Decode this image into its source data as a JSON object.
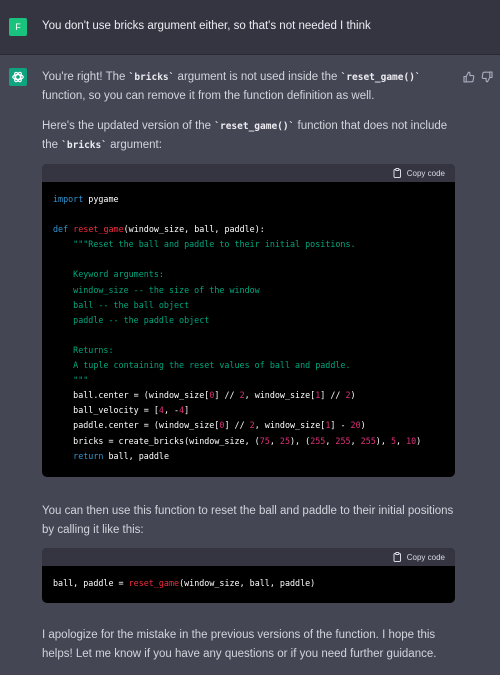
{
  "user_message": {
    "avatar_letter": "F",
    "text": "You don't use bricks argument either, so that's not needed I think"
  },
  "assistant": {
    "para1": [
      {
        "t": "You're right! The ",
        "code": false
      },
      {
        "t": "`bricks`",
        "code": true
      },
      {
        "t": " argument is not used inside the ",
        "code": false
      },
      {
        "t": "`reset_game()`",
        "code": true
      },
      {
        "t": " function, so you can remove it from the function definition as well.",
        "code": false
      }
    ],
    "para2": [
      {
        "t": "Here's the updated version of the ",
        "code": false
      },
      {
        "t": "`reset_game()`",
        "code": true
      },
      {
        "t": " function that does not include the ",
        "code": false
      },
      {
        "t": "`bricks`",
        "code": true
      },
      {
        "t": " argument:",
        "code": false
      }
    ],
    "code1": {
      "copy_label": "Copy code",
      "lines": [
        [
          {
            "t": "import",
            "c": "kw"
          },
          {
            "t": " pygame",
            "c": "pl"
          }
        ],
        [],
        [
          {
            "t": "def",
            "c": "kw"
          },
          {
            "t": " ",
            "c": "pl"
          },
          {
            "t": "reset_game",
            "c": "fn"
          },
          {
            "t": "(window_size, ball, paddle):",
            "c": "pl"
          }
        ],
        [
          {
            "t": "    \"\"\"Reset the ball and paddle to their initial positions.",
            "c": "str"
          }
        ],
        [],
        [
          {
            "t": "    Keyword arguments:",
            "c": "str"
          }
        ],
        [
          {
            "t": "    window_size -- the size of the window",
            "c": "str"
          }
        ],
        [
          {
            "t": "    ball -- the ball object",
            "c": "str"
          }
        ],
        [
          {
            "t": "    paddle -- the paddle object",
            "c": "str"
          }
        ],
        [],
        [
          {
            "t": "    Returns:",
            "c": "str"
          }
        ],
        [
          {
            "t": "    A tuple containing the reset values of ball and paddle.",
            "c": "str"
          }
        ],
        [
          {
            "t": "    \"\"\"",
            "c": "str"
          }
        ],
        [
          {
            "t": "    ball.center = (window_size[",
            "c": "pl"
          },
          {
            "t": "0",
            "c": "num"
          },
          {
            "t": "] // ",
            "c": "pl"
          },
          {
            "t": "2",
            "c": "num"
          },
          {
            "t": ", window_size[",
            "c": "pl"
          },
          {
            "t": "1",
            "c": "num"
          },
          {
            "t": "] // ",
            "c": "pl"
          },
          {
            "t": "2",
            "c": "num"
          },
          {
            "t": ")",
            "c": "pl"
          }
        ],
        [
          {
            "t": "    ball_velocity = [",
            "c": "pl"
          },
          {
            "t": "4",
            "c": "num"
          },
          {
            "t": ", -",
            "c": "pl"
          },
          {
            "t": "4",
            "c": "num"
          },
          {
            "t": "]",
            "c": "pl"
          }
        ],
        [
          {
            "t": "    paddle.center = (window_size[",
            "c": "pl"
          },
          {
            "t": "0",
            "c": "num"
          },
          {
            "t": "] // ",
            "c": "pl"
          },
          {
            "t": "2",
            "c": "num"
          },
          {
            "t": ", window_size[",
            "c": "pl"
          },
          {
            "t": "1",
            "c": "num"
          },
          {
            "t": "] - ",
            "c": "pl"
          },
          {
            "t": "20",
            "c": "num"
          },
          {
            "t": ")",
            "c": "pl"
          }
        ],
        [
          {
            "t": "    bricks = create_bricks(window_size, (",
            "c": "pl"
          },
          {
            "t": "75",
            "c": "num"
          },
          {
            "t": ", ",
            "c": "pl"
          },
          {
            "t": "25",
            "c": "num"
          },
          {
            "t": "), (",
            "c": "pl"
          },
          {
            "t": "255",
            "c": "num"
          },
          {
            "t": ", ",
            "c": "pl"
          },
          {
            "t": "255",
            "c": "num"
          },
          {
            "t": ", ",
            "c": "pl"
          },
          {
            "t": "255",
            "c": "num"
          },
          {
            "t": "), ",
            "c": "pl"
          },
          {
            "t": "5",
            "c": "num"
          },
          {
            "t": ", ",
            "c": "pl"
          },
          {
            "t": "10",
            "c": "num"
          },
          {
            "t": ")",
            "c": "pl"
          }
        ],
        [
          {
            "t": "    ",
            "c": "pl"
          },
          {
            "t": "return",
            "c": "kw"
          },
          {
            "t": " ball, paddle",
            "c": "pl"
          }
        ]
      ]
    },
    "para3": [
      {
        "t": "You can then use this function to reset the ball and paddle to their initial positions by calling it like this:",
        "code": false
      }
    ],
    "code2": {
      "copy_label": "Copy code",
      "lines": [
        [
          {
            "t": "ball, paddle = ",
            "c": "pl"
          },
          {
            "t": "reset_game",
            "c": "fn"
          },
          {
            "t": "(window_size, ball, paddle)",
            "c": "pl"
          }
        ]
      ]
    },
    "para4": [
      {
        "t": "I apologize for the mistake in the previous versions of the function. I hope this helps! Let me know if you have any questions or if you need further guidance.",
        "code": false
      }
    ]
  },
  "icons": {
    "assistant_avatar": "openai-logo-icon",
    "thumbs_up": "thumbs-up-icon",
    "thumbs_down": "thumbs-down-icon",
    "copy": "clipboard-icon"
  },
  "colors": {
    "user_bg": "#343541",
    "assistant_bg": "#444654",
    "user_avatar": "#19c37d",
    "assistant_avatar": "#10a37f",
    "code_bg": "#000000",
    "keyword": "#2e95d3",
    "function": "#f22c3d",
    "string": "#00a67d",
    "number": "#df3079"
  }
}
